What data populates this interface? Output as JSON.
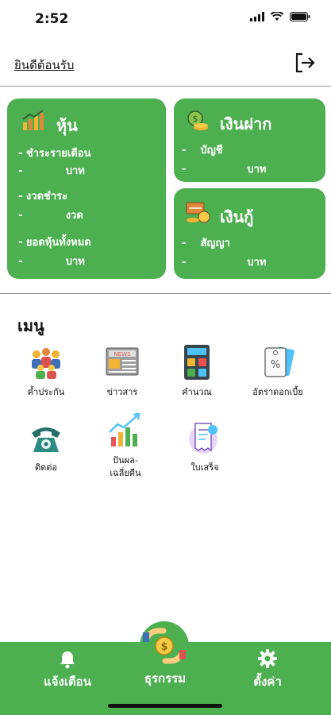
{
  "status_bar": {
    "time": "2:52"
  },
  "header": {
    "welcome": "ยินดีต้อนรับ"
  },
  "cards": {
    "shares": {
      "title": "หุ้น",
      "lines": [
        "- ชำระรายเดือน",
        "-            บาท",
        "- งวดชำระ",
        "-            งวด",
        "- ยอดหุ้นทั้งหมด",
        "-            บาท"
      ]
    },
    "deposit": {
      "title": "เงินฝาก",
      "lines": [
        "-    บัญชี",
        "-                 บาท"
      ]
    },
    "loan": {
      "title": "เงินกู้",
      "lines": [
        "-    สัญญา",
        "-                 บาท"
      ]
    }
  },
  "menu": {
    "title": "เมนู",
    "items": [
      {
        "label": "ค้ำประกัน",
        "icon": "guarantor-people-icon"
      },
      {
        "label": "ข่าวสาร",
        "icon": "newspaper-icon"
      },
      {
        "label": "คำนวณ",
        "icon": "calculator-icon"
      },
      {
        "label": "อัตราดอกเบี้ย",
        "icon": "interest-rate-tag-icon"
      },
      {
        "label": "ติดต่อ",
        "icon": "telephone-icon"
      },
      {
        "label": "ปันผล-\nเฉลี่ยคืน",
        "icon": "growth-chart-icon"
      },
      {
        "label": "ใบเสร็จ",
        "icon": "receipt-icon"
      }
    ]
  },
  "bottom_nav": {
    "notifications": "แจ้งเตือน",
    "transactions": "ธุรกรรม",
    "settings": "ตั้งค่า"
  },
  "colors": {
    "accent": "#4caf50"
  }
}
